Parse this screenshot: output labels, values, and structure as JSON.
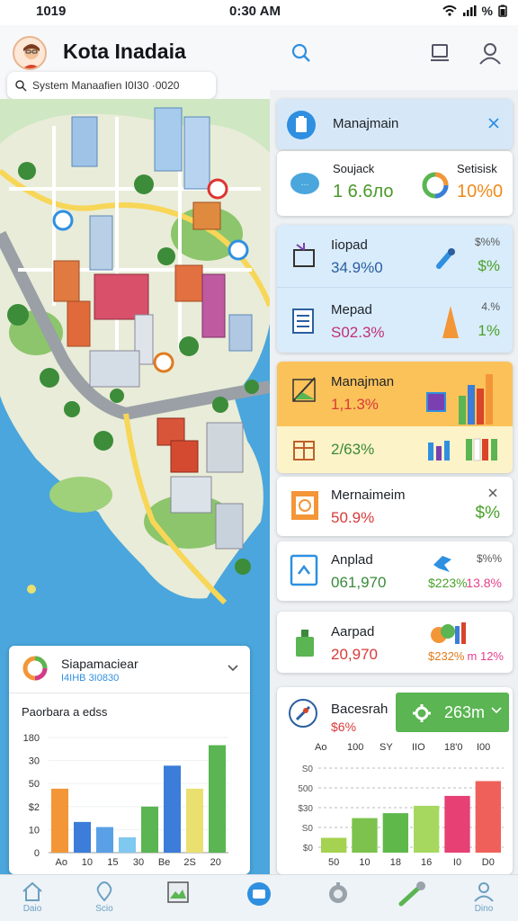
{
  "status_bar": {
    "left": "1019",
    "time": "0:30 AM",
    "battery": "%"
  },
  "header": {
    "title": "Kota Inadaia",
    "search_value": "System Manaafien  I0I30  ·0020"
  },
  "cards": [
    {
      "title": "Manajmain"
    },
    {
      "label_left": "Soujack",
      "value_left": "1 6.6ло",
      "label_right": "Setisisk",
      "value_right": "10%0"
    },
    {
      "title": "Iiopad",
      "percent": "34.9%0",
      "right_top": "$%%",
      "right_value": "$%"
    },
    {
      "title": "Mepad",
      "percent": "S02.3%",
      "right_top": "4.%",
      "right_value": "1%"
    },
    {
      "title": "Manajman",
      "percent": "1,1.3%"
    },
    {
      "value": "2/63%"
    },
    {
      "title": "Mernaimeim",
      "percent": "50.9%",
      "right_value": "$%"
    },
    {
      "title": "Anplad",
      "percent": "061,970",
      "right_left": "$223%",
      "right_right": "13.8%"
    },
    {
      "title": "Aarpad",
      "percent": "20,970",
      "right_left": "$232%",
      "right_right": "m 12%"
    },
    {
      "title": "Bacesrah",
      "percent": "$6%",
      "badge": "263m"
    }
  ],
  "bottom_left": {
    "title": "Siapamaciear",
    "subtitle": "I4IHB 3I0830",
    "chart_title": "Paorbara a  edss"
  },
  "chart_left": {
    "type": "bar",
    "y_ticks": [
      "180",
      "30",
      "50",
      "$2",
      "10",
      "0"
    ],
    "categories": [
      "Ao",
      "10",
      "15",
      "30",
      "Be",
      "2S",
      "20"
    ],
    "series": [
      {
        "color": "#f39638",
        "value": 25
      },
      {
        "color": "#3b7dd8",
        "value": 12
      },
      {
        "color": "#5aa0e6",
        "value": 10
      },
      {
        "color": "#7fc8f0",
        "value": 6
      },
      {
        "color": "#5ab552",
        "value": 18
      },
      {
        "color": "#3b7dd8",
        "value": 34
      },
      {
        "color": "#e9e070",
        "value": 25
      },
      {
        "color": "#5ab552",
        "value": 42
      }
    ],
    "ylim": [
      0,
      45
    ]
  },
  "chart_right": {
    "type": "bar",
    "x_header": [
      "Ao",
      "100",
      "SY",
      "IIO",
      "18'0",
      "I00"
    ],
    "y_ticks": [
      "S0",
      "500",
      "$30",
      "S0",
      "$0"
    ],
    "categories": [
      "50",
      "10",
      "18",
      "16",
      "I0",
      "D0"
    ],
    "values": [
      6,
      14,
      16,
      19,
      23,
      29
    ],
    "colors": [
      "#a5d250",
      "#7cc24c",
      "#5eb84a",
      "#a6d860",
      "#e64075",
      "#f0605a"
    ],
    "ylim": [
      0,
      35
    ]
  },
  "nav": [
    {
      "label": "Daio"
    },
    {
      "label": "Scio"
    },
    {
      "label": ""
    },
    {
      "label": ""
    },
    {
      "label": ""
    },
    {
      "label": ""
    },
    {
      "label": "Dino"
    }
  ],
  "colors": {
    "accent": "#2f8fe0",
    "map_water": "#4aa6dc",
    "land": "#e8ecd9",
    "road": "#f7d658"
  }
}
